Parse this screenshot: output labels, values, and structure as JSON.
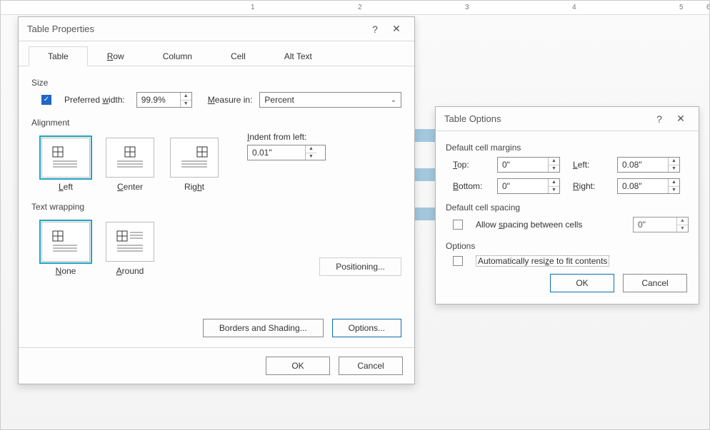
{
  "tableProps": {
    "title": "Table Properties",
    "tabs": [
      "Table",
      "ow",
      "Column",
      "Cell",
      "Alt Text"
    ],
    "size": {
      "label": "Size",
      "preferredWidthChecked": true,
      "preferredWidth": "99.9%",
      "measureIn": "Percent"
    },
    "alignment": {
      "label": "Alignment",
      "selected": "Left",
      "options": [
        "Left",
        "Center",
        "Right"
      ],
      "indentFromLeft": "0.01\""
    },
    "wrap": {
      "label": "Text wrapping",
      "selected": "None",
      "options": [
        "None",
        "Around"
      ]
    },
    "buttons": {
      "positioning": "Positioning...",
      "bordersShading": "Borders and Shading...",
      "options": "Options...",
      "ok": "OK",
      "cancel": "Cancel"
    }
  },
  "tableOptions": {
    "title": "Table Options",
    "margins": {
      "label": "Default cell margins",
      "top": "0\"",
      "bottom": "0\"",
      "left": "0.08\"",
      "right": "0.08\""
    },
    "spacing": {
      "label": "Default cell spacing",
      "allowChecked": false,
      "value": "0\""
    },
    "options": {
      "label": "Options",
      "autoResizeChecked": false,
      "autoResizeLabel": "Automatically resize to fit contents"
    },
    "buttons": {
      "ok": "OK",
      "cancel": "Cancel"
    }
  }
}
